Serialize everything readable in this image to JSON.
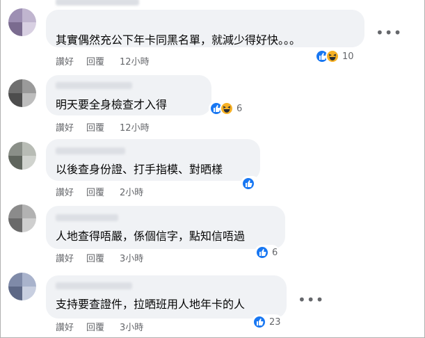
{
  "comments": [
    {
      "text": "其實偶然充公下年卡同黑名單，就減少得好快。。。",
      "like_label": "讚好",
      "reply_label": "回覆",
      "time": "12小時",
      "reactions": [
        "like",
        "haha"
      ],
      "count": "10",
      "avatar_colors": [
        "#9d8fb3",
        "#c0b5cf",
        "#7a6b8f",
        "#d8d0e2"
      ]
    },
    {
      "text": "明天要全身檢查才入得",
      "like_label": "讚好",
      "reply_label": "回覆",
      "time": "12小時",
      "reactions": [
        "like",
        "haha"
      ],
      "count": "6",
      "avatar_colors": [
        "#6f6f6f",
        "#9a9a9a",
        "#4d4d4d",
        "#bdbdbd"
      ]
    },
    {
      "text": "以後查身份證、打手指模、對晒樣",
      "like_label": "讚好",
      "reply_label": "回覆",
      "time": "2小時",
      "reactions": [
        "like"
      ],
      "count": "",
      "avatar_colors": [
        "#8a8f88",
        "#b8bcb5",
        "#5f655d",
        "#d0d3ce"
      ]
    },
    {
      "text": "人地查得唔嚴，係個信字，點知信唔過",
      "like_label": "讚好",
      "reply_label": "回覆",
      "time": "3小時",
      "reactions": [
        "like"
      ],
      "count": "6",
      "avatar_colors": [
        "#8b8b8b",
        "#b2b2b2",
        "#6a6a6a",
        "#cfcfcf"
      ]
    },
    {
      "text": "支持要查證件，拉晒班用人地年卡的人",
      "like_label": "讚好",
      "reply_label": "回覆",
      "time": "3小時",
      "reactions": [
        "like"
      ],
      "count": "23",
      "avatar_colors": [
        "#7f8aa8",
        "#a9b3cc",
        "#5d6886",
        "#c8cfe0"
      ]
    }
  ]
}
